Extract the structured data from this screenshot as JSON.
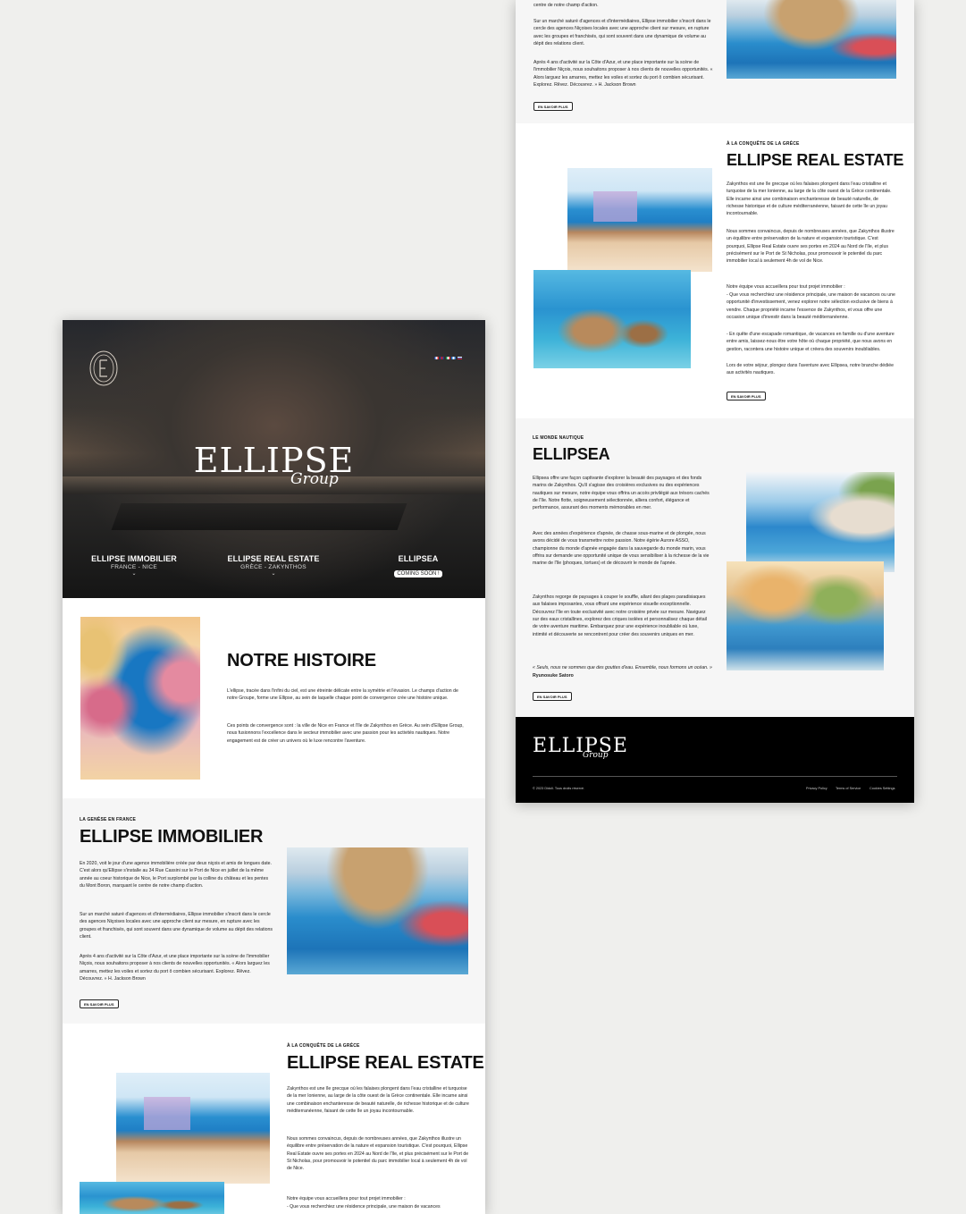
{
  "right": {
    "immo_partial": {
      "p0": "centre de notre champ d'action.",
      "p1": "Sur un marché saturé d'agences et d'intermédiaires, Ellipse immobilier s'inscrit dans le cercle des agences Niçoises locales avec une approche client sur mesure, en rupture avec les groupes et franchisés, qui sont souvent dans une dynamique de volume au dépit des relations client.",
      "p2": "Après 4 ans d'activité sur la Côte d'Azur, et une place importante sur la scène de l'immobilier Niçois, nous souhaitons proposer à nos clients de nouvelles opportunités. « Alors larguez les amarres, mettez les voiles et sortez du port ô combien sécurisant. Explorez. Rêvez. Découvrez. » H. Jackson Brown",
      "button": "EN SAVOIR PLUS"
    },
    "realestate": {
      "kicker": "À LA CONQUÊTE DE LA GRÈCE",
      "title": "ELLIPSE REAL ESTATE",
      "p1": "Zakynthos est une île grecque où les falaises plongent dans l'eau cristalline et turquoise de la mer Ionienne, au large de la côte ouest de la Grèce continentale. Elle incarne ainsi une combinaison enchanteresse de beauté naturelle, de richesse historique et de culture méditerranéenne, faisant de cette île un joyau incontournable.",
      "p2": "Nous sommes convaincus, depuis de nombreuses années, que Zakynthos illustre un équilibre entre préservation de la nature et expansion touristique. C'est pourquoi, Ellipse Real Estate ouvre ses portes en 2024 au Nord de l'île, et plus précisément sur le Port de St Nicholas, pour promouvoir le potentiel du parc immobilier local à seulement 4h de vol de Nice.",
      "p3": "Notre équipe vous accueillera pour tout projet immobilier :",
      "p4": "- Que vous recherchiez une résidence principale, une maison de vacances ou une opportunité d'investissement, venez explorer notre sélection exclusive de biens à vendre. Chaque propriété incarne l'essence de Zakynthos, et vous offre une occasion unique d'investir dans la beauté méditerranéenne.",
      "p5": "- En quête d'une escapade romantique, de vacances en famille ou d'une aventure entre amis, laissez-nous être votre hôte où chaque propriété, que nous avons en gestion, racontera une histoire unique et créera des souvenirs inoubliables.",
      "p6": "Lors de votre séjour, plongez dans l'aventure avec Ellipsea, notre branche dédiée aux activités nautiques.",
      "button": "EN SAVOIR PLUS"
    },
    "ellipsea": {
      "kicker": "LE MONDE NAUTIQUE",
      "title": "ELLIPSEA",
      "p1": "Ellipsea offre une façon captivante d'explorer la beauté des paysages et des fonds marins de Zakynthos. Qu'il s'agisse des croisières exclusives ou des expériences nautiques sur mesure, notre équipe vous offrira un accès privilégié aux trésors cachés de l'île. Notre flotte, soigneusement sélectionnée, alliera confort, élégance et performance, assurant des moments mémorables en mer.",
      "p2": "Avec des années d'expérience d'apnée, de chasse sous-marine et de plongée, nous avons décidé de vous transmettre notre passion. Notre égérie Aurore ASSO, championne du monde d'apnée engagée dans la sauvegarde du monde marin, vous offrira sur demande une opportunité unique de vous sensibiliser à la richesse de la vie marine de l'île (phoques, tortues) et de découvrir le monde de l'apnée.",
      "p3": "Zakynthos regorge de paysages à couper le souffle, allant des plages paradisiaques aux falaises imposantes, vous offrant une expérience visuelle exceptionnelle. Découvrez l'île en toute exclusivité avec notre croisière privée sur mesure. Naviguez sur des eaux cristallines, explorez des criques isolées et personnalisez chaque détail de votre aventure maritime. Embarquez pour une expérience inoubliable où luxe, intimité et découverte se rencontrent pour créer des souvenirs uniques en mer.",
      "quote": "« Seuls, nous ne sommes que des gouttes d'eau. Ensemble, nous formons un océan. »",
      "author": "Ryunosuke Satoro",
      "button": "EN SAVOIR PLUS"
    },
    "footer": {
      "logo_word": "ELLIPSE",
      "logo_script": "Group",
      "copyright": "© 2023 Didoli. Tous droits réservé.",
      "links": [
        "Privacy Policy",
        "Terms of Service",
        "Cookies Settings"
      ]
    }
  },
  "left": {
    "hero": {
      "logo_word": "ELLIPSE",
      "logo_script": "Group",
      "flags": [
        {
          "name": "france",
          "colors": [
            "#2b4fa3",
            "#ffffff",
            "#d6292f"
          ]
        },
        {
          "name": "uk",
          "colors": [
            "#1f3d8a",
            "#c8252c",
            "#1f3d8a"
          ]
        },
        {
          "name": "italy",
          "colors": [
            "#1a8f45",
            "#ffffff",
            "#d6292f"
          ]
        },
        {
          "name": "greece",
          "colors": [
            "#2a6fc4",
            "#ffffff",
            "#2a6fc4"
          ]
        },
        {
          "name": "russia",
          "colors": [
            "#ffffff",
            "#2a54b0",
            "#d6292f"
          ]
        }
      ],
      "nav": [
        {
          "title": "ELLIPSE IMMOBILIER",
          "sub": "FRANCE - NICE"
        },
        {
          "title": "ELLIPSE REAL ESTATE",
          "sub": "GRÈCE - ZAKYNTHOS"
        },
        {
          "title": "ELLIPSEA",
          "sub": "COMING SOON !"
        }
      ]
    },
    "histoire": {
      "title": "NOTRE HISTOIRE",
      "p1": "L'ellipse, tracée dans l'infini du ciel, est une étreinte délicate entre la symétrie et l'évasion. Le champs d'action de notre Groupe, forme une Ellipse, au sein de laquelle chaque point de convergence crée une histoire unique.",
      "p2": "Ces points de convergence sont : la ville de Nice en France et l'île de Zakynthos en Grèce. Au sein d'Ellipse Group, nous fusionnons l'excellence dans le secteur immobilier avec une passion pour les activités nautiques. Notre engagement est de créer un univers où le luxe rencontre l'aventure."
    },
    "immobilier": {
      "kicker": "LA GENÈSE EN FRANCE",
      "title": "ELLIPSE IMMOBILIER",
      "p1": "En 2020, voit le jour d'une agence immobilière créée par deux niçois et amis de longues date. C'est alors qu'Ellipse s'installe au 34 Rue Cassini sur le Port de Nice en juillet de la même année au coeur historique de Nice, le Port surplombé par la colline du château et les pentes du Mont Boron, marquant le centre de notre champ d'action.",
      "p2": "Sur un marché saturé d'agences et d'intermédiaires, Ellipse immobilier s'inscrit dans le cercle des agences Niçoises locales avec une approche client sur mesure, en rupture avec les groupes et franchisés, qui sont souvent dans une dynamique de volume au dépit des relations client.",
      "p3": "Après 4 ans d'activité sur la Côte d'Azur, et une place importante sur la scène de l'immobilier Niçois, nous souhaitons proposer à nos clients de nouvelles opportunités. « Alors larguez les amarres, mettez les voiles et sortez du port ô combien sécurisant. Explorez. Rêvez. Découvrez. » H. Jackson Brown",
      "button": "EN SAVOIR PLUS"
    },
    "realestate": {
      "kicker": "À LA CONQUÊTE DE LA GRÈCE",
      "title": "ELLIPSE REAL ESTATE",
      "p1": "Zakynthos est une île grecque où les falaises plongent dans l'eau cristalline et turquoise de la mer Ionienne, au large de la côte ouest de la Grèce continentale. Elle incarne ainsi une combinaison enchanteresse de beauté naturelle, de richesse historique et de culture méditerranéenne, faisant de cette île un joyau incontournable.",
      "p2": "Nous sommes convaincus, depuis de nombreuses années, que Zakynthos illustre un équilibre entre préservation de la nature et expansion touristique. C'est pourquoi, Ellipse Real Estate ouvre ses portes en 2024 au Nord de l'île, et plus précisément sur le Port de St Nicholas, pour promouvoir le potentiel du parc immobilier local à seulement 4h de vol de Nice.",
      "p3": "Notre équipe vous accueillera pour tout projet immobilier :",
      "p4": "- Que vous recherchiez une résidence principale, une maison de vacances"
    }
  }
}
